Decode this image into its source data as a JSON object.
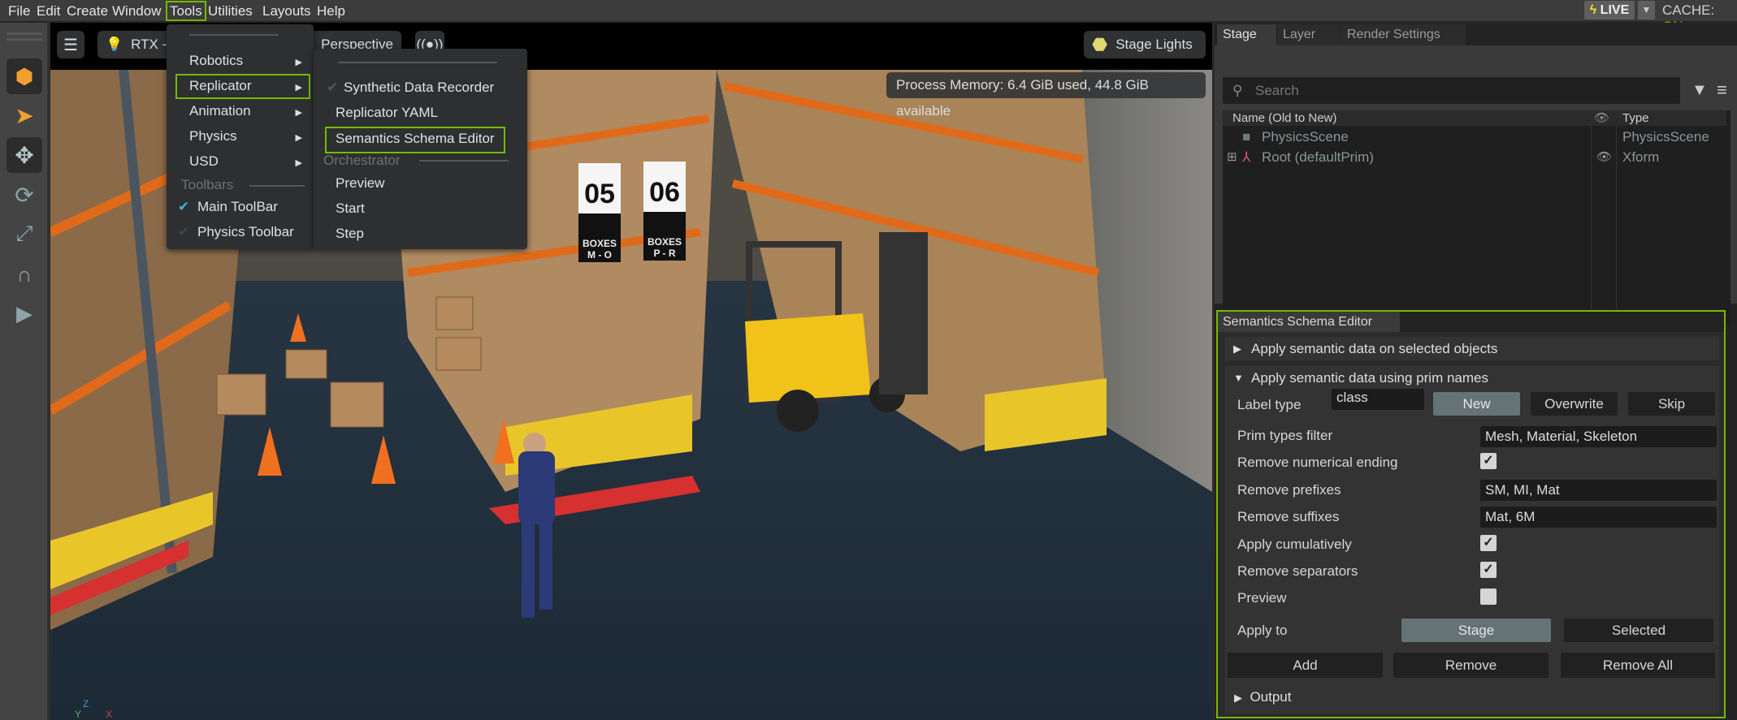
{
  "menubar": {
    "items": [
      "File",
      "Edit",
      "Create",
      "Window",
      "Tools",
      "Utilities",
      "Layouts",
      "Help"
    ],
    "active": "Tools",
    "live_label": "LIVE",
    "cache_label": "CACHE:",
    "cache_value": "ON"
  },
  "tools_menu": {
    "items": [
      {
        "label": "Robotics"
      },
      {
        "label": "Replicator"
      },
      {
        "label": "Animation"
      },
      {
        "label": "Physics"
      },
      {
        "label": "USD"
      }
    ],
    "section": "Toolbars",
    "toolbars": [
      {
        "label": "Main ToolBar",
        "checked": true
      },
      {
        "label": "Physics Toolbar",
        "checked": false
      }
    ]
  },
  "replicator_submenu": {
    "items": [
      "Synthetic Data Recorder",
      "Replicator YAML",
      "Semantics Schema Editor"
    ],
    "section": "Orchestrator",
    "orchestrator_items": [
      "Preview",
      "Start",
      "Step"
    ]
  },
  "viewport": {
    "renderer_label": "RTX -",
    "camera_label": "Perspective",
    "lights_label": "Stage Lights",
    "memory": "Process Memory: 6.4 GiB used, 44.8 GiB available",
    "signs": [
      {
        "aisle": "05",
        "label": "BOXES",
        "range": "M - O"
      },
      {
        "aisle": "06",
        "label": "BOXES",
        "range": "P - R"
      }
    ],
    "axis": {
      "z": "Z",
      "y": "Y",
      "x": "X"
    }
  },
  "stage_panel": {
    "tabs": [
      "Stage",
      "Layer",
      "Render Settings"
    ],
    "search_placeholder": "Search",
    "columns": {
      "name": "Name (Old to New)",
      "type": "Type"
    },
    "rows": [
      {
        "name": "PhysicsScene",
        "type": "PhysicsScene"
      },
      {
        "name": "Root (defaultPrim)",
        "type": "Xform"
      }
    ]
  },
  "semantics_editor": {
    "title": "Semantics Schema Editor",
    "section_selected": "Apply semantic data on selected objects",
    "section_prim": "Apply semantic data using prim names",
    "label_type": {
      "label": "Label type",
      "value": "class",
      "modes": [
        "New",
        "Overwrite",
        "Skip"
      ],
      "selected": "New"
    },
    "prim_types_filter": {
      "label": "Prim types filter",
      "value": "Mesh, Material, Skeleton"
    },
    "remove_numerical_ending": {
      "label": "Remove numerical ending",
      "checked": true
    },
    "remove_prefixes": {
      "label": "Remove prefixes",
      "value": "SM, MI, Mat"
    },
    "remove_suffixes": {
      "label": "Remove suffixes",
      "value": "Mat, 6M"
    },
    "apply_cumulatively": {
      "label": "Apply cumulatively",
      "checked": true
    },
    "remove_separators": {
      "label": "Remove separators",
      "checked": true
    },
    "preview": {
      "label": "Preview",
      "checked": false
    },
    "apply_to": {
      "label": "Apply to",
      "options": [
        "Stage",
        "Selected"
      ],
      "selected": "Stage"
    },
    "actions": [
      "Add",
      "Remove",
      "Remove All"
    ],
    "output": "Output"
  },
  "colors": {
    "accent": "#76b900",
    "check": "#3daee9"
  }
}
